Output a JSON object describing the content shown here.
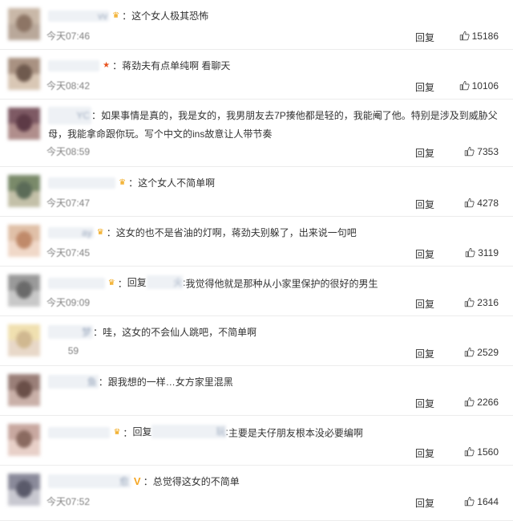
{
  "reply_label": "回复",
  "comments": [
    {
      "user": "         vv",
      "badge": "crown",
      "text": "这个女人极其恐怖",
      "time": "今天07:46",
      "likes": "15186",
      "avatar": [
        "#c9b8a8",
        "#b9a89a",
        "#8d7565"
      ]
    },
    {
      "user": "         ",
      "badge": "star",
      "text": "蒋劲夫有点单纯啊 看聊天",
      "time": "今天08:42",
      "likes": "10106",
      "avatar": [
        "#a99282",
        "#d9c7b5",
        "#6f5a4e"
      ]
    },
    {
      "user": "     YC",
      "badge": "",
      "text": "如果事情是真的，我是女的，我男朋友去7P揍他都是轻的，我能阉了他。特别是涉及到威胁父母，我能拿命跟你玩。写个中文的ins故意让人带节奏",
      "time": "今天08:59",
      "likes": "7353",
      "avatar": [
        "#7e5a64",
        "#b08e8c",
        "#5d3a46"
      ],
      "wrap": true
    },
    {
      "user": "            ",
      "badge": "crown",
      "text": "这个女人不简单啊",
      "time": "今天07:47",
      "likes": "4278",
      "avatar": [
        "#7a8a6a",
        "#c3c0a8",
        "#5b6b58"
      ]
    },
    {
      "user": "      ay",
      "badge": "crown",
      "text": "这女的也不是省油的灯啊，蒋劲夫别躲了，出来说一句吧",
      "time": "今天07:45",
      "likes": "3119",
      "avatar": [
        "#e0c0a8",
        "#f0d8c8",
        "#c08a6a"
      ]
    },
    {
      "user": "          ",
      "badge": "crown",
      "text": "我觉得他就是那种从小家里保护的很好的男生",
      "reply_prefix": "回复",
      "reply_name": "     火",
      "time": "今天09:09",
      "likes": "2316",
      "avatar": [
        "#9a9a9a",
        "#c8c8c8",
        "#6a6a6a"
      ]
    },
    {
      "user": "      梦",
      "badge": "",
      "text": "哇，这女的不会仙人跳吧，不简单啊",
      "time": "    59",
      "likes": "2529",
      "avatar": [
        "#f0e0b0",
        "#e8d8c8",
        "#d0b890"
      ]
    },
    {
      "user": "       鱼",
      "badge": "",
      "text": "跟我想的一样…女方家里混黑",
      "time": "      ",
      "likes": "2266",
      "avatar": [
        "#9a7f78",
        "#c9b0a8",
        "#6a4f48"
      ]
    },
    {
      "user": "           ",
      "badge": "crown",
      "text": "主要是夫仔朋友根本没必要编啊",
      "reply_prefix": "回复",
      "reply_name": "            玩",
      "time": "      ",
      "likes": "1560",
      "avatar": [
        "#c8a8a0",
        "#e8d0c8",
        "#8a6a60"
      ]
    },
    {
      "user": "             愈",
      "badge": "v",
      "text": "总觉得这女的不简单",
      "time": "今天07:52",
      "likes": "1644",
      "avatar": [
        "#8a8a9a",
        "#c8c8d0",
        "#5a5a6a"
      ]
    }
  ]
}
